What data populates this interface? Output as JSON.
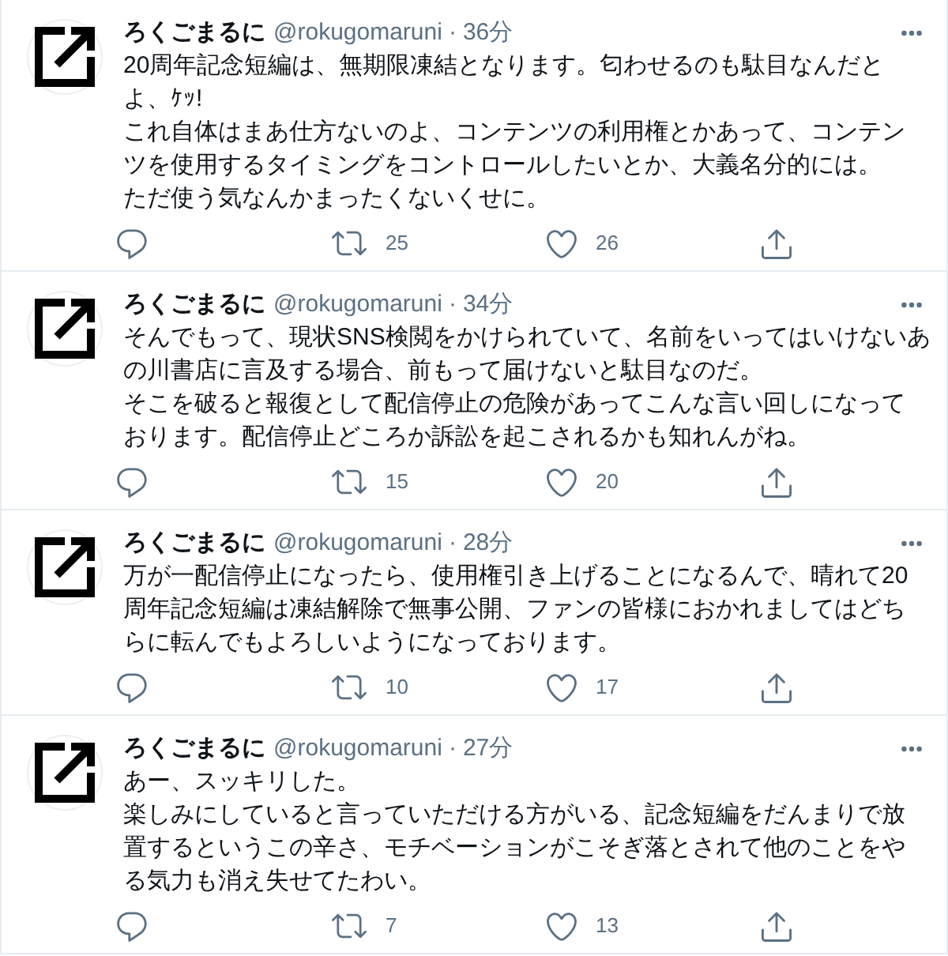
{
  "tweets": [
    {
      "author": {
        "name": "ろくごまるに",
        "handle": "@rokugomaruni"
      },
      "separator": "·",
      "time": "36分",
      "lines": [
        "20周年記念短編は、無期限凍結となります。匂わせるのも駄目なんだと",
        "よ、ｹｯ!",
        "これ自体はまあ仕方ないのよ、コンテンツの利用権とかあって、コンテン",
        "ツを使用するタイミングをコントロールしたいとか、大義名分的には。",
        "ただ使う気なんかまったくないくせに。"
      ],
      "retweets": "25",
      "likes": "26"
    },
    {
      "author": {
        "name": "ろくごまるに",
        "handle": "@rokugomaruni"
      },
      "separator": "·",
      "time": "34分",
      "lines": [
        "そんでもって、現状SNS検閲をかけられていて、名前をいってはいけないあ",
        "の川書店に言及する場合、前もって届けないと駄目なのだ。",
        "そこを破ると報復として配信停止の危険があってこんな言い回しになって",
        "おります。配信停止どころか訴訟を起こされるかも知れんがね。"
      ],
      "retweets": "15",
      "likes": "20"
    },
    {
      "author": {
        "name": "ろくごまるに",
        "handle": "@rokugomaruni"
      },
      "separator": "·",
      "time": "28分",
      "lines": [
        "万が一配信停止になったら、使用権引き上げることになるんで、晴れて20",
        "周年記念短編は凍結解除で無事公開、ファンの皆様におかれましてはどち",
        "らに転んでもよろしいようになっております。"
      ],
      "retweets": "10",
      "likes": "17"
    },
    {
      "author": {
        "name": "ろくごまるに",
        "handle": "@rokugomaruni"
      },
      "separator": "·",
      "time": "27分",
      "lines": [
        "あー、スッキリした。",
        "楽しみにしていると言っていただける方がいる、記念短編をだんまりで放",
        "置するというこの辛さ、モチベーションがこそぎ落とされて他のことをや",
        "る気力も消え失せてたわい。"
      ],
      "retweets": "7",
      "likes": "13"
    }
  ]
}
